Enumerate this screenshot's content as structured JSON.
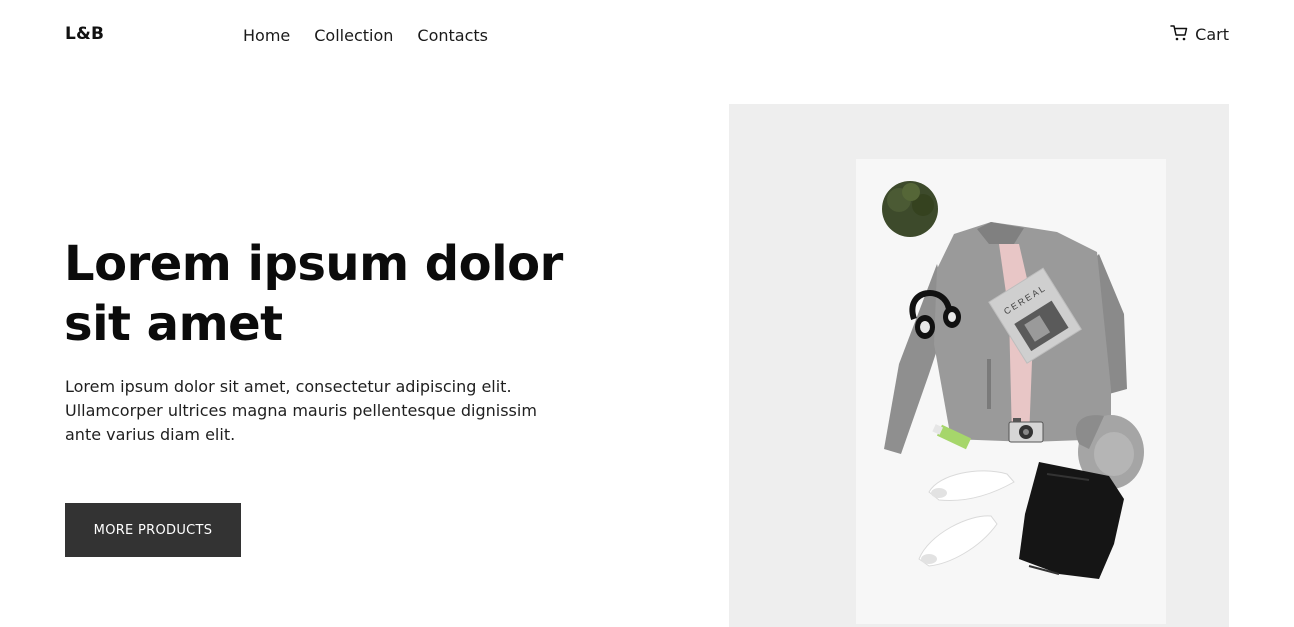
{
  "header": {
    "logo": "L&B",
    "nav": [
      {
        "label": "Home"
      },
      {
        "label": "Collection"
      },
      {
        "label": "Contacts"
      }
    ],
    "cart": {
      "label": "Cart",
      "icon": "cart-icon"
    }
  },
  "hero": {
    "title": "Lorem ipsum dolor sit amet",
    "text": "Lorem ipsum dolor sit amet, consectetur adipiscing elit. Ullamcorper ultrices magna mauris pellentesque dignissim ante varius diam elit.",
    "button_label": "MORE PRODUCTS",
    "image": {
      "magazine_text": "CEREAL"
    }
  },
  "colors": {
    "button_bg": "#333333",
    "image_bg": "#eeeeee",
    "text": "#111111"
  }
}
